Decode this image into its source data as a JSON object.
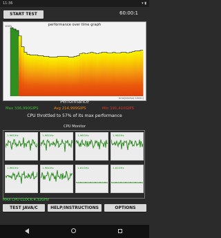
{
  "status_bar": {
    "time": "11:36",
    "right": ""
  },
  "header": {
    "start_label": "START TEST",
    "timer": "60:00:1"
  },
  "graph": {
    "title": "performance over time graph",
    "y_labels": [
      "100%",
      "80%",
      "60%",
      "40%",
      "20%",
      "0%"
    ],
    "footer": "time(interval 10min)"
  },
  "performance": {
    "title": "Performance",
    "max": "Max 336,990GIPS",
    "avg": "Avg 214,999GIPS",
    "min": "Min 191,410GIPS",
    "throttle": "CPU throttled to 57% of its max performance"
  },
  "cpu_monitor": {
    "label": "CPU Monitor",
    "max_clock": "MAX CPU CLOCK:4.32GHz",
    "cores": [
      {
        "freq": "1.96GHz"
      },
      {
        "freq": "1.96GHz"
      },
      {
        "freq": "1.96GHz"
      },
      {
        "freq": "1.96GHz"
      },
      {
        "freq": "1.96GHz"
      },
      {
        "freq": "1.96GHz"
      },
      {
        "freq": "1.61GHz"
      },
      {
        "freq": "1.61GHz"
      }
    ]
  },
  "bottom_buttons": {
    "java_label": "TEST JAVA/C",
    "help_label": "HELP/INSTRUCTIONS",
    "options_label": "OPTIONS"
  },
  "chart_data": {
    "type": "bar",
    "title": "performance over time graph",
    "ylim": [
      0,
      100
    ],
    "values": [
      100,
      98,
      96,
      88,
      72,
      64,
      61,
      60,
      60,
      60,
      59,
      59,
      58,
      58,
      57,
      57,
      57,
      58,
      58,
      58,
      58,
      57,
      57,
      58,
      59,
      62,
      63,
      62,
      63,
      64,
      63,
      62,
      63,
      64,
      64,
      63,
      63,
      64,
      63,
      63,
      64,
      64,
      63,
      64,
      65,
      66,
      66,
      67
    ],
    "color_high": "#2f8f1f",
    "color_mid": "#f4c20d",
    "color_low": "#e64a0b",
    "background": "#f3f3f3"
  },
  "colors": {
    "max_stat": "#3fbf3f",
    "avg_stat": "#f08a1c",
    "min_stat": "#d93a2a",
    "core_line": "#2e8b22"
  }
}
